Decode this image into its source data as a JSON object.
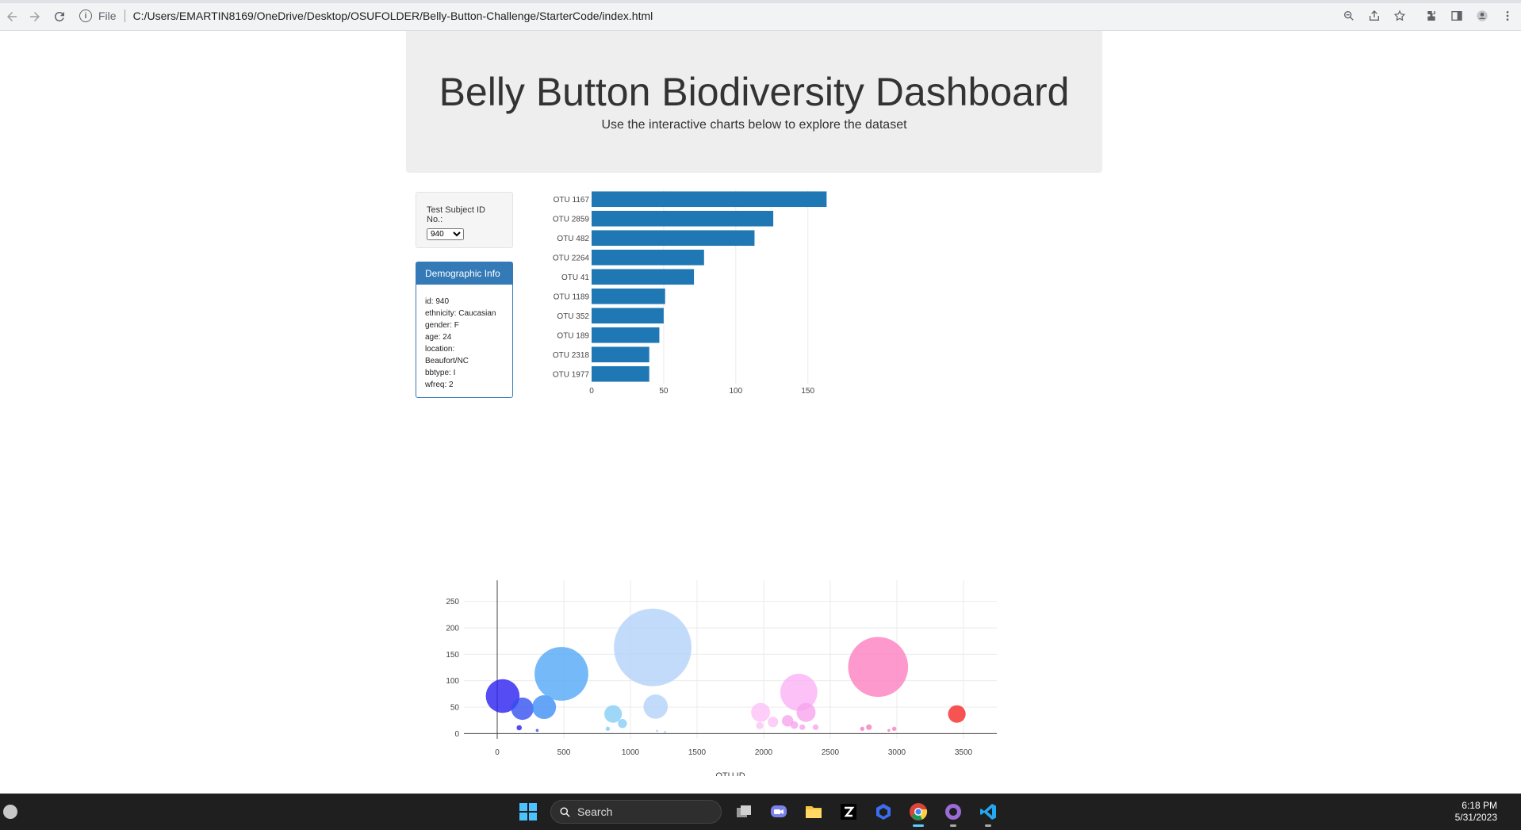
{
  "browser": {
    "url_scheme": "File",
    "url": "C:/Users/EMARTIN8169/OneDrive/Desktop/OSUFOLDER/Belly-Button-Challenge/StarterCode/index.html"
  },
  "header": {
    "title": "Belly Button Biodiversity Dashboard",
    "subtitle": "Use the interactive charts below to explore the dataset"
  },
  "selector": {
    "label": "Test Subject ID No.:",
    "selected": "940"
  },
  "demographics": {
    "title": "Demographic Info",
    "lines": [
      "id: 940",
      "ethnicity: Caucasian",
      "gender: F",
      "age: 24",
      "location:",
      "Beaufort/NC",
      "bbtype: I",
      "wfreq: 2"
    ]
  },
  "colors": {
    "bar": "#1f77b4",
    "panel": "#337ab7"
  },
  "chart_data": [
    {
      "type": "bar",
      "orientation": "horizontal",
      "categories": [
        "OTU 1167",
        "OTU 2859",
        "OTU 482",
        "OTU 2264",
        "OTU 41",
        "OTU 1189",
        "OTU 352",
        "OTU 189",
        "OTU 2318",
        "OTU 1977"
      ],
      "values": [
        163,
        126,
        113,
        78,
        71,
        51,
        50,
        47,
        40,
        40
      ],
      "xlim": [
        0,
        165
      ],
      "xticks": [
        0,
        50,
        100,
        150
      ],
      "grid": true
    },
    {
      "type": "scatter",
      "subtype": "bubble",
      "xlabel": "OTU ID",
      "xlim": [
        -250,
        3750
      ],
      "ylim": [
        -10,
        290
      ],
      "xticks": [
        0,
        500,
        1000,
        1500,
        2000,
        2500,
        3000,
        3500
      ],
      "yticks": [
        0,
        50,
        100,
        150,
        200,
        250
      ],
      "grid": true,
      "points": [
        {
          "x": 41,
          "y": 71,
          "color": "#2a1ff0"
        },
        {
          "x": 189,
          "y": 47,
          "color": "#3550f0"
        },
        {
          "x": 352,
          "y": 50,
          "color": "#3f8ef5"
        },
        {
          "x": 482,
          "y": 113,
          "color": "#53a7f7"
        },
        {
          "x": 165,
          "y": 11,
          "color": "#2a1ff0"
        },
        {
          "x": 300,
          "y": 6,
          "color": "#3550f0"
        },
        {
          "x": 870,
          "y": 37,
          "color": "#86cdf6"
        },
        {
          "x": 940,
          "y": 19,
          "color": "#86cdf6"
        },
        {
          "x": 830,
          "y": 9,
          "color": "#86cdf6"
        },
        {
          "x": 1167,
          "y": 163,
          "color": "#b4d2fa"
        },
        {
          "x": 1189,
          "y": 51,
          "color": "#b4d2fa"
        },
        {
          "x": 1200,
          "y": 5,
          "color": "#b4d2fa"
        },
        {
          "x": 1260,
          "y": 3,
          "color": "#b4d2fa"
        },
        {
          "x": 1977,
          "y": 40,
          "color": "#fbc2f6"
        },
        {
          "x": 2070,
          "y": 22,
          "color": "#fbc2f6"
        },
        {
          "x": 1970,
          "y": 15,
          "color": "#fbc2f6"
        },
        {
          "x": 2264,
          "y": 78,
          "color": "#fbb1f5"
        },
        {
          "x": 2318,
          "y": 40,
          "color": "#f8a4ec"
        },
        {
          "x": 2180,
          "y": 24,
          "color": "#f8a4ec"
        },
        {
          "x": 2230,
          "y": 16,
          "color": "#f8a4ec"
        },
        {
          "x": 2290,
          "y": 12,
          "color": "#f8a4ec"
        },
        {
          "x": 2390,
          "y": 12,
          "color": "#f8a4ec"
        },
        {
          "x": 2859,
          "y": 126,
          "color": "#fc80c0"
        },
        {
          "x": 2740,
          "y": 9,
          "color": "#f57ec0"
        },
        {
          "x": 2790,
          "y": 12,
          "color": "#f57ec0"
        },
        {
          "x": 2940,
          "y": 6,
          "color": "#f57ec0"
        },
        {
          "x": 2980,
          "y": 9,
          "color": "#f57ec0"
        },
        {
          "x": 3450,
          "y": 37,
          "color": "#f52828"
        }
      ]
    }
  ],
  "taskbar": {
    "search_placeholder": "Search",
    "time": "6:18 PM",
    "date": "5/31/2023"
  }
}
